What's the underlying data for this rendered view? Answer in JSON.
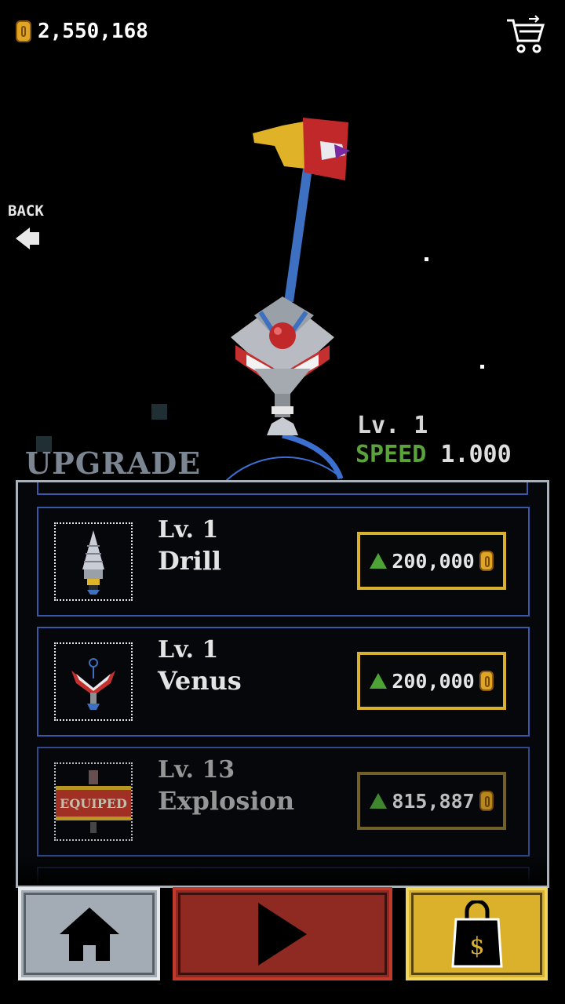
{
  "header": {
    "coin_balance": "2,550,168",
    "cart_icon": "shopping-cart-icon"
  },
  "back": {
    "label": "BACK",
    "icon": "arrow-left-icon"
  },
  "stats": {
    "level": "Lv. 1",
    "speed_label": "SPEED",
    "speed_value": "1.000"
  },
  "upgrade_title": "UPGRADE",
  "items": [
    {
      "level": "Lv. 1",
      "name": "Drill",
      "price": "200,000",
      "icon": "drill-ship-icon",
      "equipped": false
    },
    {
      "level": "Lv. 1",
      "name": "Venus",
      "price": "200,000",
      "icon": "venus-ship-icon",
      "equipped": false
    },
    {
      "level": "Lv. 13",
      "name": "Explosion",
      "price": "815,887",
      "icon": "explosion-ship-icon",
      "equipped": true,
      "badge": "EQUIPED"
    }
  ],
  "nav": {
    "home_icon": "home-icon",
    "play_icon": "play-icon",
    "shop_icon": "shopping-bag-icon"
  },
  "colors": {
    "speed_green": "#5aa23a",
    "card_border": "#3b58a8",
    "price_border": "#d9b030",
    "play_red": "#8f2a22",
    "shop_gold": "#dbb12c"
  }
}
